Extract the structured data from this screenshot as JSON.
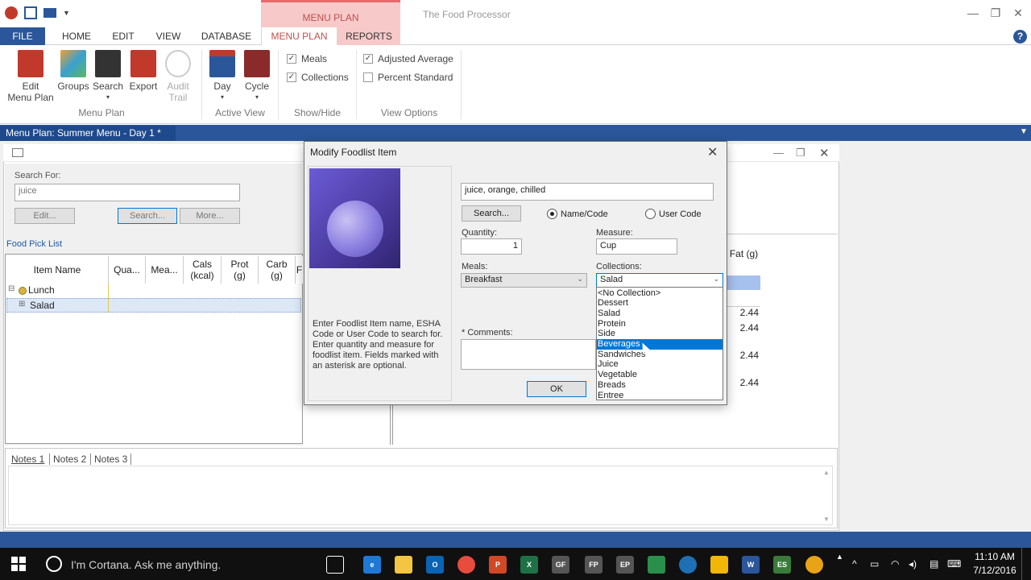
{
  "app": {
    "title": "The Food Processor",
    "context_tab_header": "MENU PLAN"
  },
  "tabs": [
    {
      "label": "FILE"
    },
    {
      "label": "HOME"
    },
    {
      "label": "EDIT"
    },
    {
      "label": "VIEW"
    },
    {
      "label": "DATABASE"
    },
    {
      "label": "MENU PLAN"
    },
    {
      "label": "REPORTS"
    }
  ],
  "ribbon": {
    "edit_menu_plan": "Edit\nMenu Plan",
    "groups": "Groups",
    "search": "Search",
    "export": "Export",
    "audit_trail": "Audit\nTrail",
    "group_menu_plan": "Menu Plan",
    "day": "Day",
    "cycle": "Cycle",
    "group_active_view": "Active View",
    "meals": "Meals",
    "collections": "Collections",
    "group_show_hide": "Show/Hide",
    "adjusted_average": "Adjusted Average",
    "percent_standard": "Percent Standard",
    "group_view_options": "View Options"
  },
  "doc_tab": "Menu Plan: Summer Menu - Day 1 *",
  "search_panel": {
    "search_for_label": "Search For:",
    "search_value": "juice",
    "edit_btn": "Edit...",
    "search_btn": "Search...",
    "more_btn": "More...",
    "food_pick_list": "Food Pick List"
  },
  "grid": {
    "headers": [
      "Item Name",
      "Qua...",
      "Mea...",
      "Cals\n(kcal)",
      "Prot\n(g)",
      "Carb\n(g)",
      "F"
    ],
    "rows": [
      {
        "toggle": "⊟",
        "name": "Lunch"
      },
      {
        "toggle": "⊞",
        "name": "Salad"
      }
    ]
  },
  "right_pane": {
    "fat_header": "Fat (g)",
    "values": [
      "2.44",
      "2.44",
      "2.44",
      "2.44"
    ]
  },
  "notes_tabs": [
    "Notes 1",
    "Notes 2",
    "Notes 3"
  ],
  "dialog": {
    "title": "Modify Foodlist Item",
    "help_text": "Enter Foodlist Item name, ESHA Code or User Code to search for. Enter quantity and measure for foodlist item. Fields marked with an asterisk are optional.",
    "item_value": "juice, orange, chilled",
    "search_btn": "Search...",
    "radio_name_code": "Name/Code",
    "radio_user_code": "User Code",
    "quantity_label": "Quantity:",
    "quantity_value": "1",
    "measure_label": "Measure:",
    "measure_value": "Cup",
    "meals_label": "Meals:",
    "meals_value": "Breakfast",
    "collections_label": "Collections:",
    "collections_value": "Salad",
    "comments_label": "* Comments:",
    "ok_btn": "OK",
    "collection_options": [
      "<No Collection>",
      "Dessert",
      "Salad",
      "Protein",
      "Side",
      "Beverages",
      "Sandwiches",
      "Juice",
      "Vegetable",
      "Breads",
      "Entree"
    ],
    "highlighted_option": "Beverages"
  },
  "taskbar": {
    "cortana": "I'm Cortana. Ask me anything.",
    "time": "11:10 AM",
    "date": "7/12/2016"
  }
}
